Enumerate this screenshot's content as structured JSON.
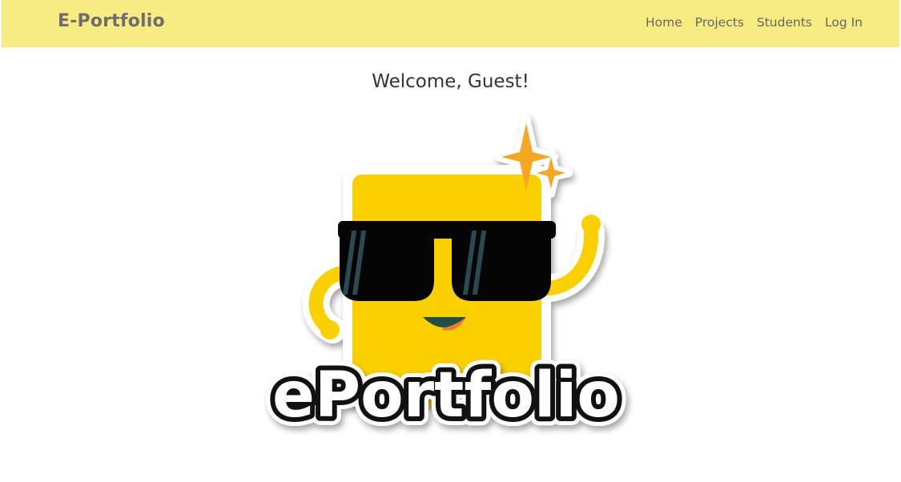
{
  "navbar": {
    "brand": "E-Portfolio",
    "links": [
      {
        "label": "Home"
      },
      {
        "label": "Projects"
      },
      {
        "label": "Students"
      },
      {
        "label": "Log In"
      }
    ],
    "background_color": "#f7ec82"
  },
  "main": {
    "welcome_text": "Welcome, Guest!",
    "logo": {
      "wordmark": "ePortfolio",
      "mascot_color": "#fbd000",
      "sparkle_color": "#f5a623"
    }
  }
}
